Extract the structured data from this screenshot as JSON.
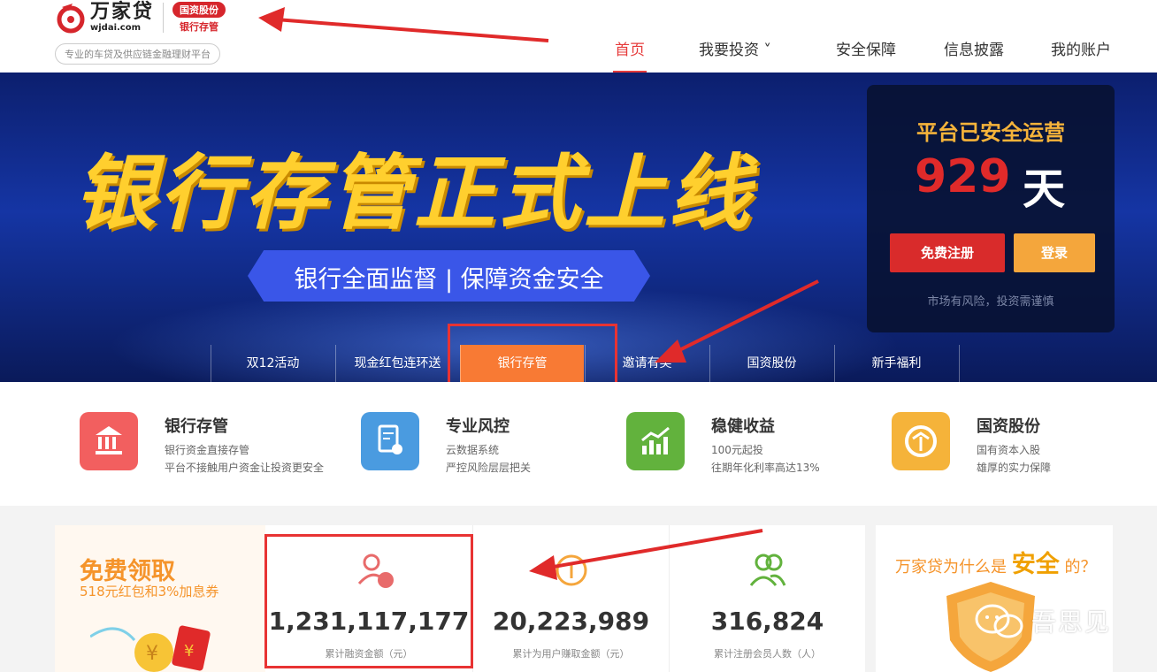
{
  "header": {
    "logo_cn": "万家贷",
    "logo_en": "wjdai.com",
    "badge_top": "国资股份",
    "badge_bottom": "银行存管",
    "slogan": "专业的车贷及供应链金融理财平台",
    "nav": [
      {
        "label": "首页",
        "active": true
      },
      {
        "label": "我要投资 ˅",
        "active": false
      },
      {
        "label": "安全保障",
        "active": false
      },
      {
        "label": "信息披露",
        "active": false
      },
      {
        "label": "我的账户",
        "active": false
      }
    ]
  },
  "banner": {
    "headline": "银行存管正式上线",
    "ribbon": "银行全面监督 | 保障资金安全",
    "tabs": [
      "双12活动",
      "现金红包连环送",
      "银行存管",
      "邀请有奖",
      "国资股份",
      "新手福利"
    ],
    "active_tab": "银行存管"
  },
  "panel": {
    "title": "平台已安全运营",
    "days": "929",
    "days_unit": "天",
    "register_label": "免费注册",
    "login_label": "登录",
    "risk_note": "市场有风险，投资需谨慎"
  },
  "features": [
    {
      "title": "银行存管",
      "line1": "银行资金直接存管",
      "line2": "平台不接触用户资金让投资更安全",
      "icon": "bank-icon",
      "color": "#f25f5f"
    },
    {
      "title": "专业风控",
      "line1": "云数据系统",
      "line2": "严控风险层层把关",
      "icon": "document-shield-icon",
      "color": "#4a9be0"
    },
    {
      "title": "稳健收益",
      "line1": "100元起投",
      "line2": "往期年化利率高达13%",
      "icon": "growth-chart-icon",
      "color": "#62b23d"
    },
    {
      "title": "国资股份",
      "line1": "国有资本入股",
      "line2": "雄厚的实力保障",
      "icon": "state-capital-icon",
      "color": "#f5b33a"
    }
  ],
  "promo": {
    "title": "免费领取",
    "subtitle": "518元红包和3%加息券"
  },
  "stats": [
    {
      "value": "1,231,117,177",
      "label": "累计融资金额（元）",
      "icon": "user-money-icon",
      "color": "#e86b6b"
    },
    {
      "value": "20,223,989",
      "label": "累计为用户赚取金额（元）",
      "icon": "coin-icon",
      "color": "#f5a63c"
    },
    {
      "value": "316,824",
      "label": "累计注册会员人数（人）",
      "icon": "users-icon",
      "color": "#62b23d"
    }
  ],
  "safety": {
    "prefix": "万家贷为什么是",
    "strong": "安全",
    "suffix": "的？"
  },
  "watermark": "吾思见"
}
